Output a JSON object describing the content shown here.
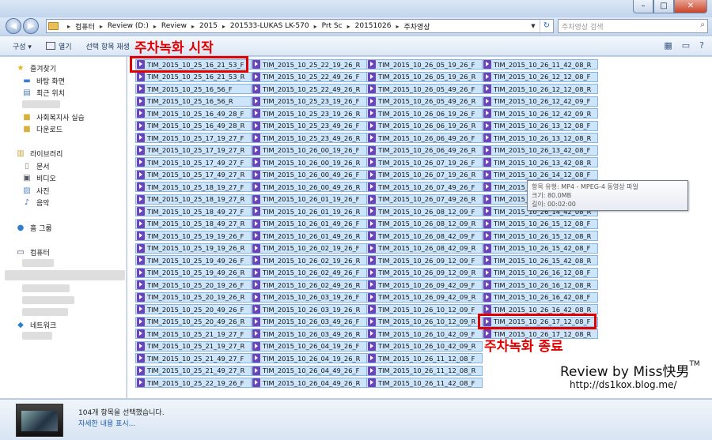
{
  "window": {
    "minimize": "–",
    "maximize": "□",
    "close": "✕"
  },
  "address": {
    "crumbs": [
      "컴퓨터",
      "Review (D:)",
      "Review",
      "2015",
      "201533-LUKAS LK-570",
      "Prt Sc",
      "20151026",
      "주차영상"
    ],
    "search_placeholder": "주차영상 검색"
  },
  "toolbar": {
    "organize": "구성 ▾",
    "open": "열기",
    "select_items": "선택 항목 재생"
  },
  "navpane": {
    "favorites": "즐겨찾기",
    "desktop": "바탕 화면",
    "recent": "최근 위치",
    "social": "사회복지사 실습",
    "downloads": "다운로드",
    "libraries": "라이브러리",
    "documents": "문서",
    "videos": "비디오",
    "pictures": "사진",
    "music": "음악",
    "homegroup": "홈 그룹",
    "computer": "컴퓨터",
    "network": "네트워크"
  },
  "files": {
    "col1": [
      "TIM_2015_10_25_16_21_53_F",
      "TIM_2015_10_25_16_21_53_R",
      "TIM_2015_10_25_16_56_F",
      "TIM_2015_10_25_16_56_R",
      "TIM_2015_10_25_16_49_28_F",
      "TIM_2015_10_25_16_49_28_R",
      "TIM_2015_10_25_17_19_27_F",
      "TIM_2015_10_25_17_19_27_R",
      "TIM_2015_10_25_17_49_27_F",
      "TIM_2015_10_25_17_49_27_R",
      "TIM_2015_10_25_18_19_27_F",
      "TIM_2015_10_25_18_19_27_R",
      "TIM_2015_10_25_18_49_27_F",
      "TIM_2015_10_25_18_49_27_R",
      "TIM_2015_10_25_19_19_26_F",
      "TIM_2015_10_25_19_19_26_R",
      "TIM_2015_10_25_19_49_26_F",
      "TIM_2015_10_25_19_49_26_R",
      "TIM_2015_10_25_20_19_26_F",
      "TIM_2015_10_25_20_19_26_R",
      "TIM_2015_10_25_20_49_26_F",
      "TIM_2015_10_25_20_49_26_R",
      "TIM_2015_10_25_21_19_27_F",
      "TIM_2015_10_25_21_19_27_R",
      "TIM_2015_10_25_21_49_27_F",
      "TIM_2015_10_25_21_49_27_R",
      "TIM_2015_10_25_22_19_26_F"
    ],
    "col2": [
      "TIM_2015_10_25_22_19_26_R",
      "TIM_2015_10_25_22_49_26_F",
      "TIM_2015_10_25_22_49_26_R",
      "TIM_2015_10_25_23_19_26_F",
      "TIM_2015_10_25_23_19_26_R",
      "TIM_2015_10_25_23_49_26_F",
      "TIM_2015_10_25_23_49_26_R",
      "TIM_2015_10_26_00_19_26_F",
      "TIM_2015_10_26_00_19_26_R",
      "TIM_2015_10_26_00_49_26_F",
      "TIM_2015_10_26_00_49_26_R",
      "TIM_2015_10_26_01_19_26_F",
      "TIM_2015_10_26_01_19_26_R",
      "TIM_2015_10_26_01_49_26_F",
      "TIM_2015_10_26_01_49_26_R",
      "TIM_2015_10_26_02_19_26_F",
      "TIM_2015_10_26_02_19_26_R",
      "TIM_2015_10_26_02_49_26_F",
      "TIM_2015_10_26_02_49_26_R",
      "TIM_2015_10_26_03_19_26_F",
      "TIM_2015_10_26_03_19_26_R",
      "TIM_2015_10_26_03_49_26_F",
      "TIM_2015_10_26_03_49_26_R",
      "TIM_2015_10_26_04_19_26_F",
      "TIM_2015_10_26_04_19_26_R",
      "TIM_2015_10_26_04_49_26_F",
      "TIM_2015_10_26_04_49_26_R"
    ],
    "col3": [
      "TIM_2015_10_26_05_19_26_F",
      "TIM_2015_10_26_05_19_26_R",
      "TIM_2015_10_26_05_49_26_F",
      "TIM_2015_10_26_05_49_26_R",
      "TIM_2015_10_26_06_19_26_F",
      "TIM_2015_10_26_06_19_26_R",
      "TIM_2015_10_26_06_49_26_F",
      "TIM_2015_10_26_06_49_26_R",
      "TIM_2015_10_26_07_19_26_F",
      "TIM_2015_10_26_07_19_26_R",
      "TIM_2015_10_26_07_49_26_F",
      "TIM_2015_10_26_07_49_26_R",
      "TIM_2015_10_26_08_12_09_F",
      "TIM_2015_10_26_08_12_09_R",
      "TIM_2015_10_26_08_42_09_F",
      "TIM_2015_10_26_08_42_09_R",
      "TIM_2015_10_26_09_12_09_F",
      "TIM_2015_10_26_09_12_09_R",
      "TIM_2015_10_26_09_42_09_F",
      "TIM_2015_10_26_09_42_09_R",
      "TIM_2015_10_26_10_12_09_F",
      "TIM_2015_10_26_10_12_09_R",
      "TIM_2015_10_26_10_42_09_F",
      "TIM_2015_10_26_10_42_09_R",
      "TIM_2015_10_26_11_12_08_F",
      "TIM_2015_10_26_11_12_08_R",
      "TIM_2015_10_26_11_42_08_F"
    ],
    "col4": [
      "TIM_2015_10_26_11_42_08_R",
      "TIM_2015_10_26_12_12_08_F",
      "TIM_2015_10_26_12_12_08_R",
      "TIM_2015_10_26_12_42_09_F",
      "TIM_2015_10_26_12_42_09_R",
      "TIM_2015_10_26_13_12_08_F",
      "TIM_2015_10_26_13_12_08_R",
      "TIM_2015_10_26_13_42_08_F",
      "TIM_2015_10_26_13_42_08_R",
      "TIM_2015_10_26_14_12_08_F",
      "TIM_2015_10_26_14_12_08_R",
      "TIM_2015_10_26_14_42_08_F",
      "TIM_2015_10_26_14_42_08_R",
      "TIM_2015_10_26_15_12_08_F",
      "TIM_2015_10_26_15_12_08_R",
      "TIM_2015_10_26_15_42_08_F",
      "TIM_2015_10_26_15_42_08_R",
      "TIM_2015_10_26_16_12_08_F",
      "TIM_2015_10_26_16_12_08_R",
      "TIM_2015_10_26_16_42_08_F",
      "TIM_2015_10_26_16_42_08_R",
      "TIM_2015_10_26_17_12_08_F",
      "TIM_2015_10_26_17_12_08_R"
    ]
  },
  "tooltip": {
    "type": "항목 유형: MP4 - MPEG-4 동영상 파일",
    "size": "크기: 80.0MB",
    "length": "길이: 00:02:00"
  },
  "annotations": {
    "start": "주차녹화 시작",
    "end": "주차녹화 종료"
  },
  "watermark": {
    "review": "Review by ",
    "brand": "Miss快男",
    "tm": "TM",
    "url": "http://ds1kox.blog.me/"
  },
  "details": {
    "selected": "104개 항목을 선택했습니다.",
    "more": "자세한 내용 표시..."
  }
}
